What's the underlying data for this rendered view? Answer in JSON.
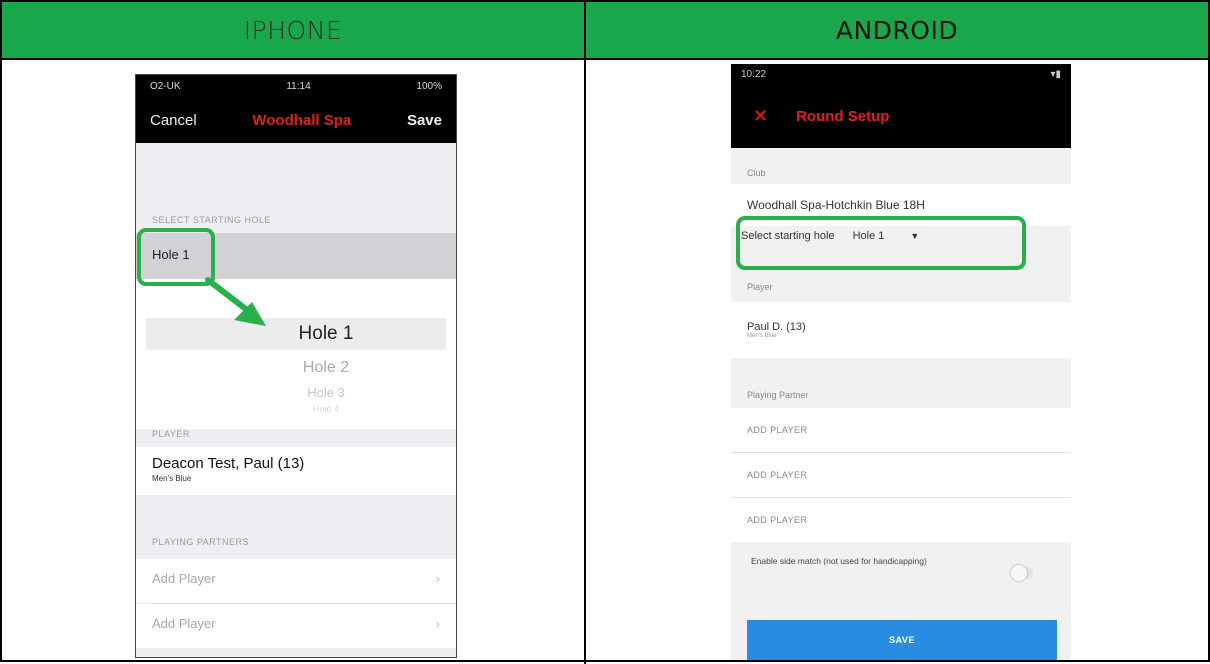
{
  "headers": {
    "iphone": "IPHONE",
    "android": "ANDROID"
  },
  "iphone": {
    "status": {
      "carrier": "O2-UK",
      "time": "11:14",
      "battery": "100%"
    },
    "nav": {
      "cancel": "Cancel",
      "title": "Woodhall Spa",
      "save": "Save"
    },
    "section_starting_hole": "SELECT STARTING HOLE",
    "selected_hole": "Hole 1",
    "picker": [
      "Hole 1",
      "Hole 2",
      "Hole 3",
      "Hole 4"
    ],
    "section_player": "PLAYER",
    "player": {
      "name": "Deacon Test, Paul (13)",
      "tee": "Men's Blue"
    },
    "section_partners": "PLAYING PARTNERS",
    "add_player": [
      "Add Player",
      "Add Player"
    ]
  },
  "android": {
    "status": {
      "time": "10:22"
    },
    "title": "Round Setup",
    "label_club": "Club",
    "club": "Woodhall Spa-Hotchkin Blue 18H",
    "starting_hole_label": "Select starting hole",
    "starting_hole_value": "Hole 1",
    "label_player": "Player",
    "player": {
      "name": "Paul D. (13)",
      "tee": "Men's Blue"
    },
    "label_partner": "Playing Partner",
    "add_player": [
      "ADD PLAYER",
      "ADD PLAYER",
      "ADD PLAYER"
    ],
    "side_match": "Enable side match (not used for handicapping)",
    "save": "SAVE"
  },
  "colors": {
    "header_green": "#1aa64a",
    "highlight_green": "#28b04a",
    "title_red": "#e02020",
    "save_blue": "#2a8ce0"
  }
}
